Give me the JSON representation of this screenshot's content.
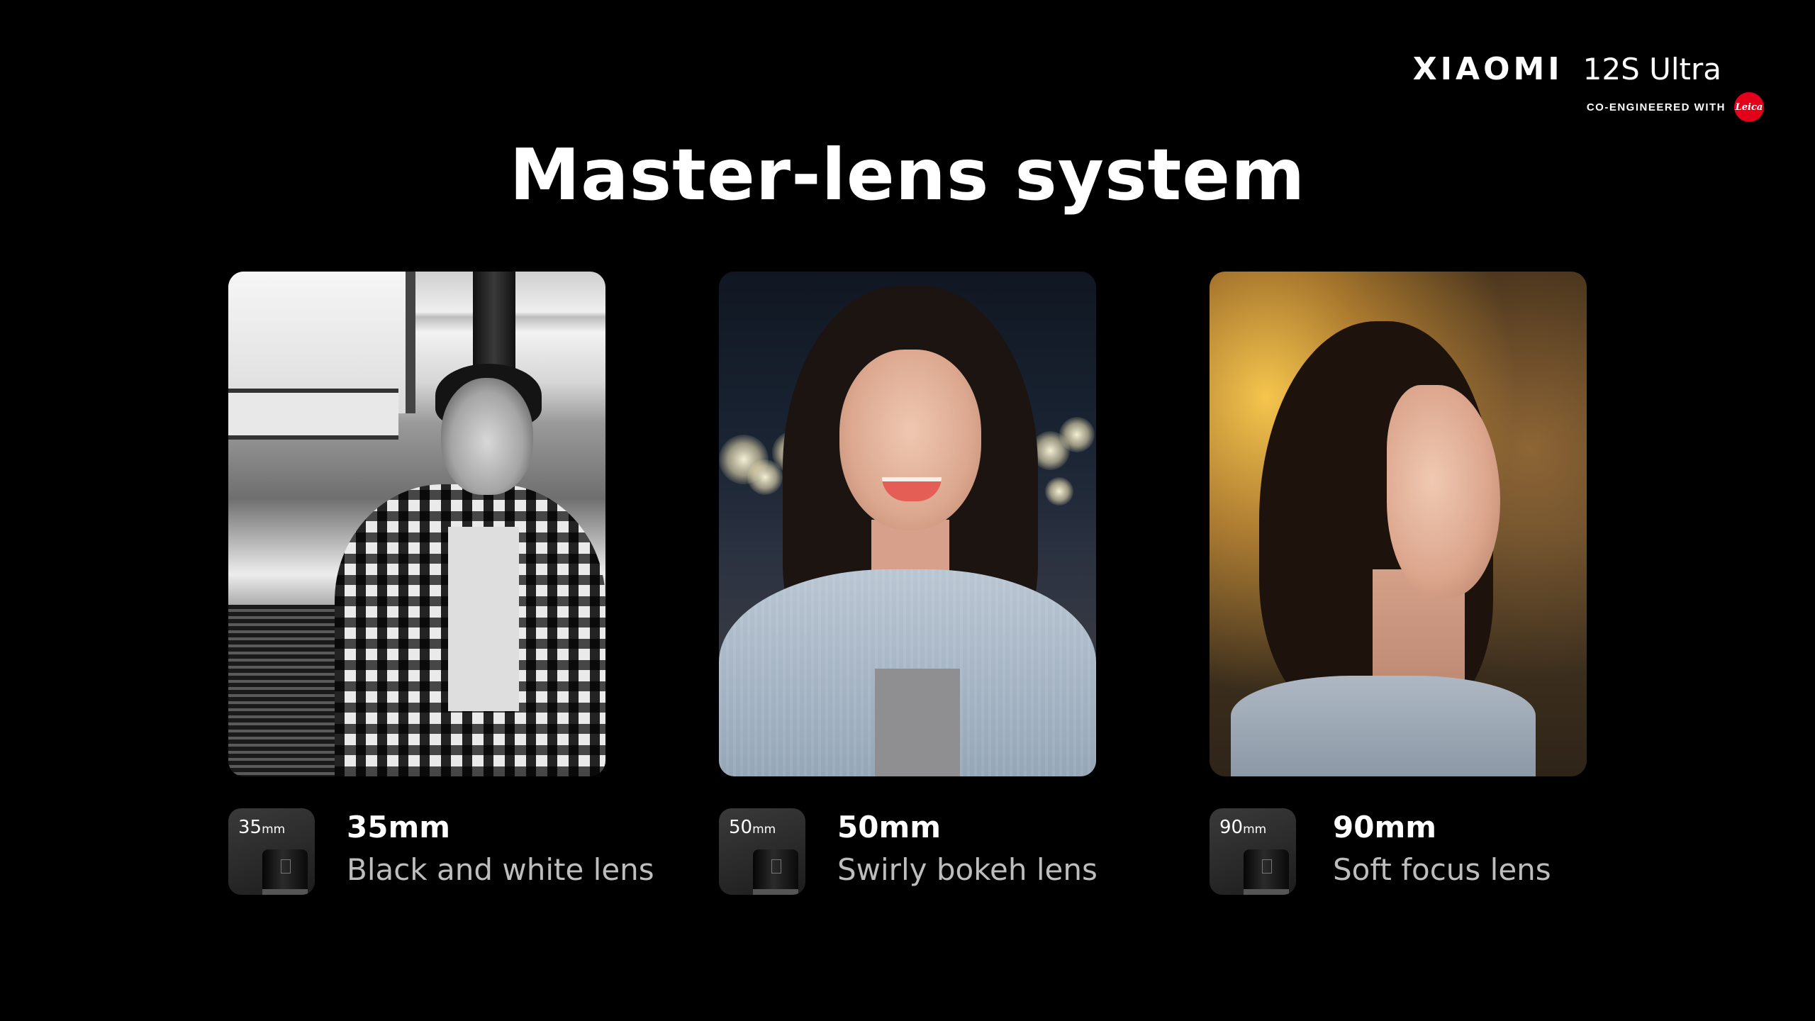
{
  "brand": {
    "name": "XIAOMI",
    "model": "12S Ultra",
    "co_engineered": "CO-ENGINEERED WITH",
    "partner_logo": "Leica"
  },
  "title": "Master-lens system",
  "lenses": [
    {
      "badge_value": "35",
      "badge_unit": "mm",
      "name": "35mm",
      "description": "Black and white lens",
      "photo": "black-and-white-portrait"
    },
    {
      "badge_value": "50",
      "badge_unit": "mm",
      "name": "50mm",
      "description": "Swirly bokeh lens",
      "photo": "swirly-bokeh-portrait"
    },
    {
      "badge_value": "90",
      "badge_unit": "mm",
      "name": "90mm",
      "description": "Soft focus lens",
      "photo": "soft-focus-portrait"
    }
  ],
  "colors": {
    "background": "#000000",
    "text_primary": "#ffffff",
    "text_secondary": "#bdbdbd",
    "leica_red": "#e2001a"
  }
}
